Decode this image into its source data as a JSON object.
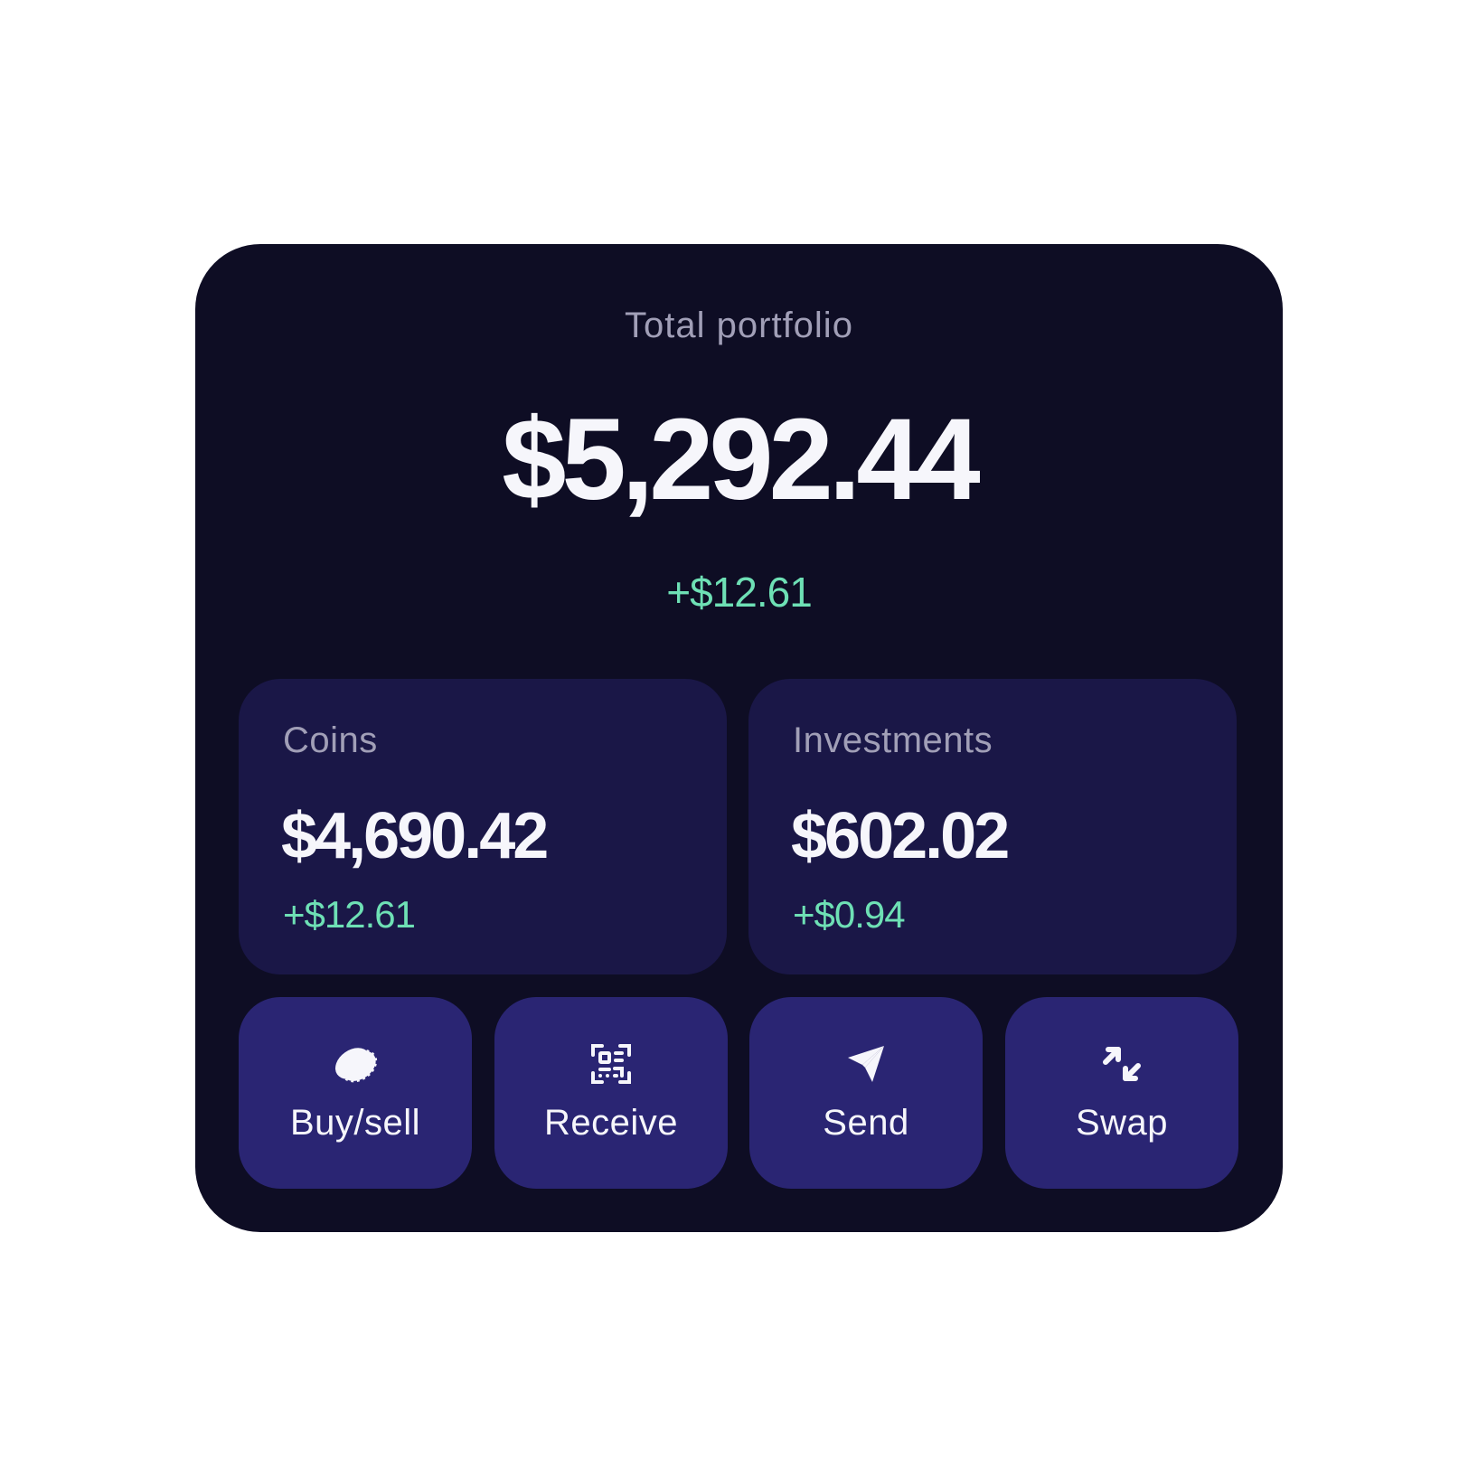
{
  "portfolio": {
    "label": "Total portfolio",
    "value": "$5,292.44",
    "change": "+$12.61"
  },
  "cards": {
    "coins": {
      "label": "Coins",
      "value": "$4,690.42",
      "change": "+$12.61"
    },
    "investments": {
      "label": "Investments",
      "value": "$602.02",
      "change": "+$0.94"
    }
  },
  "actions": [
    {
      "label": "Buy/sell",
      "icon": "coin-icon"
    },
    {
      "label": "Receive",
      "icon": "qr-code-icon"
    },
    {
      "label": "Send",
      "icon": "paper-plane-icon"
    },
    {
      "label": "Swap",
      "icon": "swap-arrows-icon"
    }
  ],
  "colors": {
    "background": "#0e0d24",
    "card": "#1a1747",
    "action": "#2a2573",
    "positive": "#6ee0b5",
    "muted": "#a19fb7",
    "text": "#f6f6fb"
  }
}
